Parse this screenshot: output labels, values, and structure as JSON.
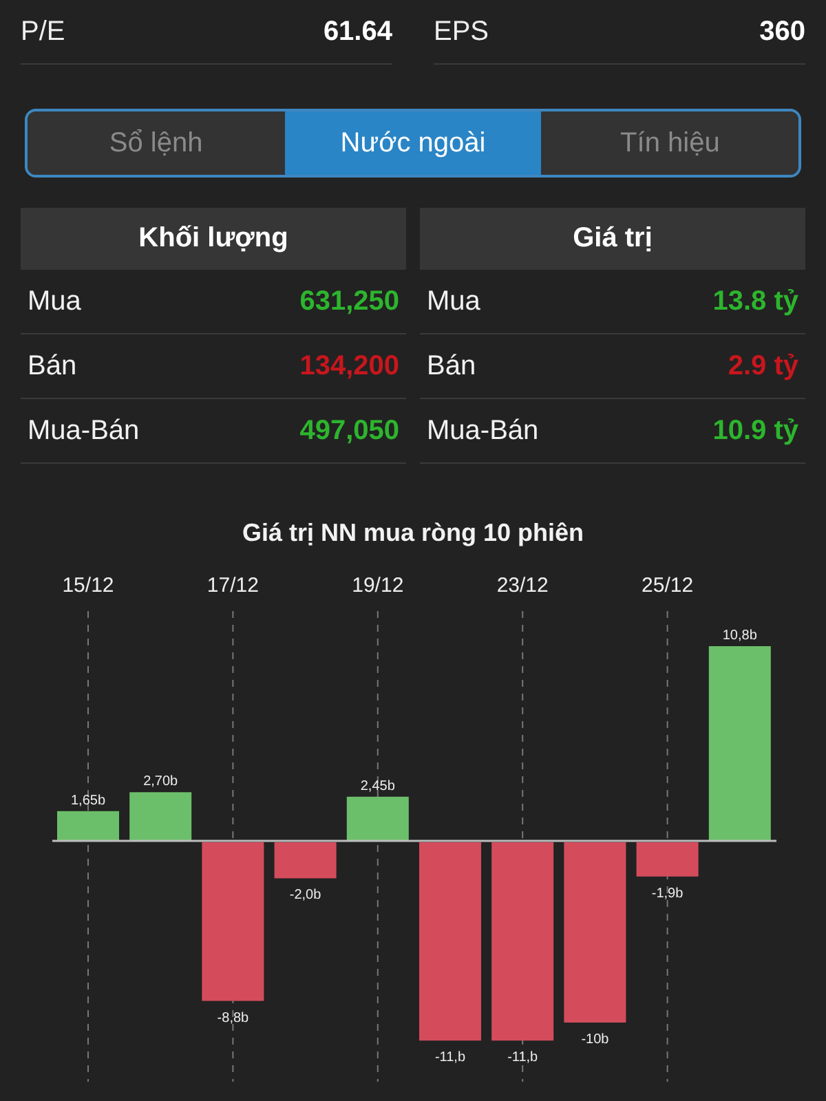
{
  "stats": [
    {
      "label": "P/E",
      "value": "61.64"
    },
    {
      "label": "EPS",
      "value": "360"
    }
  ],
  "tabs": [
    {
      "label": "Sổ lệnh",
      "selected": false
    },
    {
      "label": "Nước ngoài",
      "selected": true
    },
    {
      "label": "Tín hiệu",
      "selected": false
    }
  ],
  "tables": [
    {
      "title": "Khối lượng",
      "rows": [
        {
          "label": "Mua",
          "value": "631,250",
          "color": "#2db52d"
        },
        {
          "label": "Bán",
          "value": "134,200",
          "color": "#c8161d"
        },
        {
          "label": "Mua-Bán",
          "value": "497,050",
          "color": "#2db52d"
        }
      ]
    },
    {
      "title": "Giá trị",
      "rows": [
        {
          "label": "Mua",
          "value": "13.8 tỷ",
          "color": "#2db52d"
        },
        {
          "label": "Bán",
          "value": "2.9 tỷ",
          "color": "#c8161d"
        },
        {
          "label": "Mua-Bán",
          "value": "10.9 tỷ",
          "color": "#2db52d"
        }
      ]
    }
  ],
  "chart": {
    "title": "Giá trị NN mua ròng 10 phiên",
    "chart_data": {
      "type": "bar",
      "grid": true,
      "categories": [
        "15/12",
        null,
        "17/12",
        null,
        "19/12",
        null,
        "23/12",
        null,
        "25/12",
        null
      ],
      "values": [
        1.65,
        2.7,
        -8.8,
        -2.0,
        2.45,
        -11,
        -11,
        -10,
        -1.9,
        10.8
      ],
      "value_labels": [
        "1,65b",
        "2,70b",
        "-8,8b",
        "-2,0b",
        "2,45b",
        "-11,b",
        "-11,b",
        "-10b",
        "-1,9b",
        "10,8b"
      ]
    }
  }
}
